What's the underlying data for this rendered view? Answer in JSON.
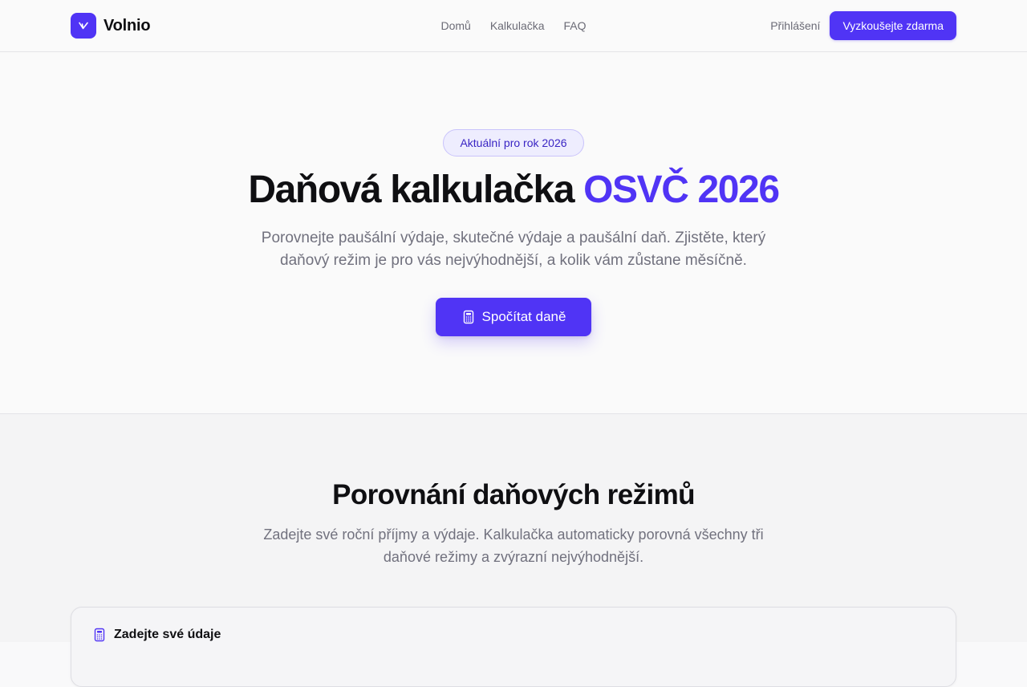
{
  "brand": {
    "name": "Volnio",
    "accent": "#5034f5"
  },
  "nav": {
    "links": [
      "Domů",
      "Kalkulačka",
      "FAQ"
    ],
    "login": "Přihlášení",
    "cta": "Vyzkoušejte zdarma"
  },
  "hero": {
    "badge": "Aktuální pro rok 2026",
    "title_main": "Daňová kalkulačka",
    "title_accent": "OSVČ 2026",
    "subtitle": "Porovnejte paušální výdaje, skutečné výdaje a paušální daň. Zjistěte, který daňový režim je pro vás nejvýhodnější, a kolik vám zůstane měsíčně.",
    "button": "Spočítat daně"
  },
  "comparison": {
    "title": "Porovnání daňových režimů",
    "subtitle": "Zadejte své roční příjmy a výdaje. Kalkulačka automaticky porovná všechny tři daňové režimy a zvýrazní nejvýhodnější.",
    "card_title": "Zadejte své údaje"
  },
  "icons": {
    "logo": "v-mark-icon",
    "calculator": "calculator-icon"
  }
}
